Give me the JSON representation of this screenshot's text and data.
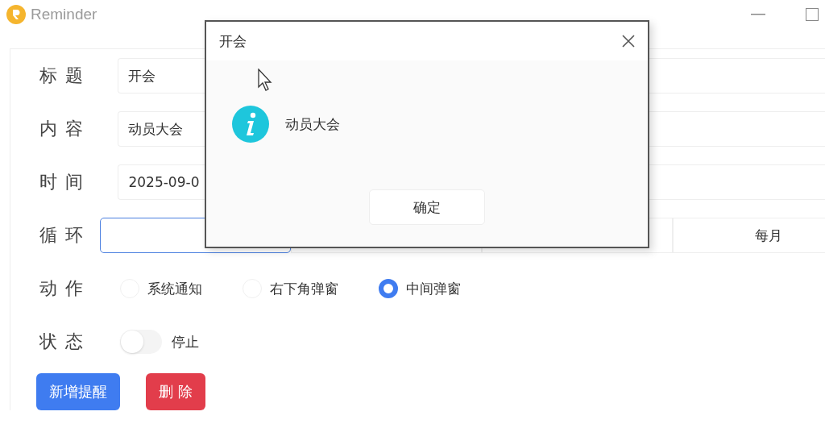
{
  "app": {
    "title": "Reminder"
  },
  "fields": [
    {
      "label": "标题",
      "value": "开会"
    },
    {
      "label": "内容",
      "value": "动员大会"
    },
    {
      "label": "时间",
      "value": "2025-09-0"
    }
  ],
  "repeat": {
    "label": "循环",
    "options": [
      {
        "selected": true
      },
      {
        "selected": false
      },
      {
        "selected": false
      },
      {
        "label": "每月",
        "selected": false
      }
    ]
  },
  "action": {
    "label": "动作",
    "options": [
      {
        "label": "系统通知",
        "selected": false
      },
      {
        "label": "右下角弹窗",
        "selected": false
      },
      {
        "label": "中间弹窗",
        "selected": true
      }
    ]
  },
  "status": {
    "label": "状态",
    "on": false,
    "text": "停止"
  },
  "buttons": [
    {
      "label": "新增提醒",
      "kind": "primary"
    },
    {
      "label": "删除",
      "kind": "danger"
    }
  ],
  "dialog": {
    "title": "开会",
    "message": "动员大会",
    "button": "确定"
  }
}
